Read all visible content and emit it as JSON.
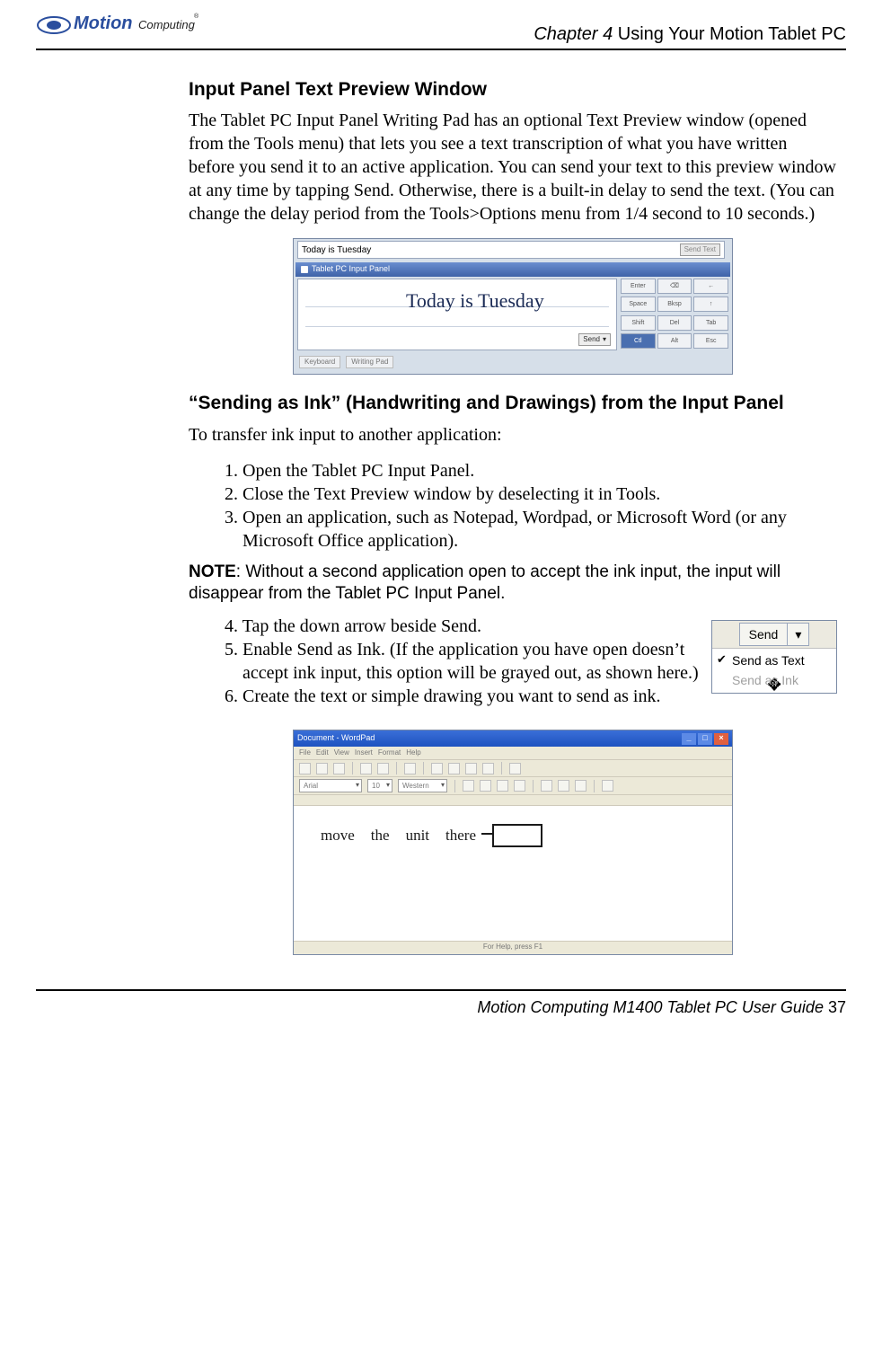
{
  "header": {
    "logo_text_a": "Motion",
    "logo_text_b": "Computing",
    "chapter_word": "Chapter 4",
    "chapter_title": " Using Your Motion Tablet PC"
  },
  "section1": {
    "heading": "Input Panel Text Preview Window",
    "para": "The Tablet PC Input Panel Writing Pad has an optional Text Preview window (opened from the Tools menu) that lets you see a text transcription of what you have written before you send it to an active application. You can send your text to this preview window at any time by tapping Send. Otherwise, there is a built-in delay to send the text. (You can change the delay period from the Tools>Options menu from 1/4 second to 10 seconds.)"
  },
  "figure1": {
    "preview_text": "Today is Tuesday",
    "send_text_btn": "Send Text",
    "panel_title": "Tablet PC Input Panel",
    "cursive": "Today is Tuesday",
    "send_btn": "Send",
    "send_arrow": "▾",
    "keys": [
      "Enter",
      "⌫",
      "←",
      "→",
      "Space",
      "Bksp",
      "↑",
      "↓",
      "Shift",
      "Del",
      "Tab",
      "Ctl",
      "Alt",
      "Esc"
    ],
    "tabs": [
      "Keyboard",
      "Writing Pad"
    ]
  },
  "section2": {
    "heading": "“Sending as Ink” (Handwriting and Drawings) from the Input Panel",
    "intro": "To transfer ink input to another application:",
    "steps_a": [
      "1. Open the Tablet PC Input Panel.",
      "2. Close the Text Preview window by deselecting it in Tools.",
      "3. Open an application, such as Notepad, Wordpad, or Microsoft Word (or any Microsoft Office application)."
    ],
    "note_label": "NOTE",
    "note_body": ": Without a second application open to accept the ink input, the input will disappear from the Tablet PC Input Panel.",
    "steps_b": [
      "4. Tap the down arrow beside Send.",
      "5. Enable Send as Ink. (If the application you have open doesn’t accept ink input, this option will be grayed out, as shown here.)",
      "6. Create the text or simple drawing you want to send as ink."
    ]
  },
  "send_menu": {
    "button": "Send",
    "arrow": "▾",
    "item1": "Send as Text",
    "item2": "Send as Ink"
  },
  "wordpad": {
    "title": "Document - WordPad",
    "menus": [
      "File",
      "Edit",
      "View",
      "Insert",
      "Format",
      "Help"
    ],
    "font_name": "Arial",
    "font_size": "10",
    "script": "Western",
    "ink_words": [
      "move",
      "the",
      "unit",
      "there"
    ],
    "status": "For Help, press F1"
  },
  "footer": {
    "text": "Motion Computing M1400 Tablet PC User Guide ",
    "page": "37"
  }
}
